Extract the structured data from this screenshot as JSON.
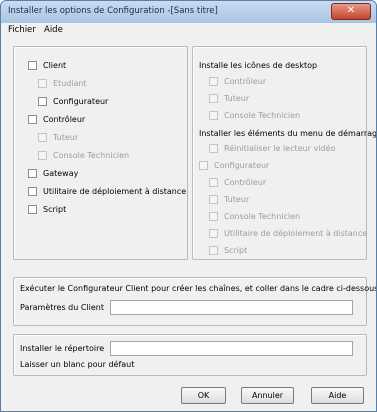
{
  "window": {
    "title": "Installer les options de Configuration -[Sans titre]",
    "close_glyph": "✕"
  },
  "menu": {
    "file": "Fichier",
    "help": "Aide"
  },
  "left_panel": {
    "client": "Client",
    "etudiant": "Etudiant",
    "configurateur": "Configurateur",
    "controleur": "Contrôleur",
    "tuteur": "Tuteur",
    "console": "Console Technicien",
    "gateway": "Gateway",
    "deploy": "Utilitaire de déploiement à distance",
    "script": "Script"
  },
  "right_panel": {
    "desktop_heading": "Installe les icônes de desktop",
    "desk_controleur": "Contrôleur",
    "desk_tuteur": "Tuteur",
    "desk_console": "Console Technicien",
    "startmenu_heading": "Installer les éléments du menu de démarrage",
    "reset_video": "Réinitialiser le lecteur vidéo",
    "sm_configurateur": "Configurateur",
    "sm_controleur": "Contrôleur",
    "sm_tuteur": "Tuteur",
    "sm_console": "Console Technicien",
    "sm_deploy": "Utilitaire de déploiement à distance",
    "sm_script": "Script"
  },
  "client_section": {
    "instruction": "Exécuter le Configurateur Client pour créer les chaînes, et coller dans le cadre ci-dessous.",
    "params_label": "Paramètres du Client",
    "params_value": ""
  },
  "dir_section": {
    "label": "Installer le répertoire",
    "hint": "Laisser un blanc pour défaut",
    "value": ""
  },
  "buttons": {
    "ok": "OK",
    "cancel": "Annuler",
    "help": "Aide"
  }
}
